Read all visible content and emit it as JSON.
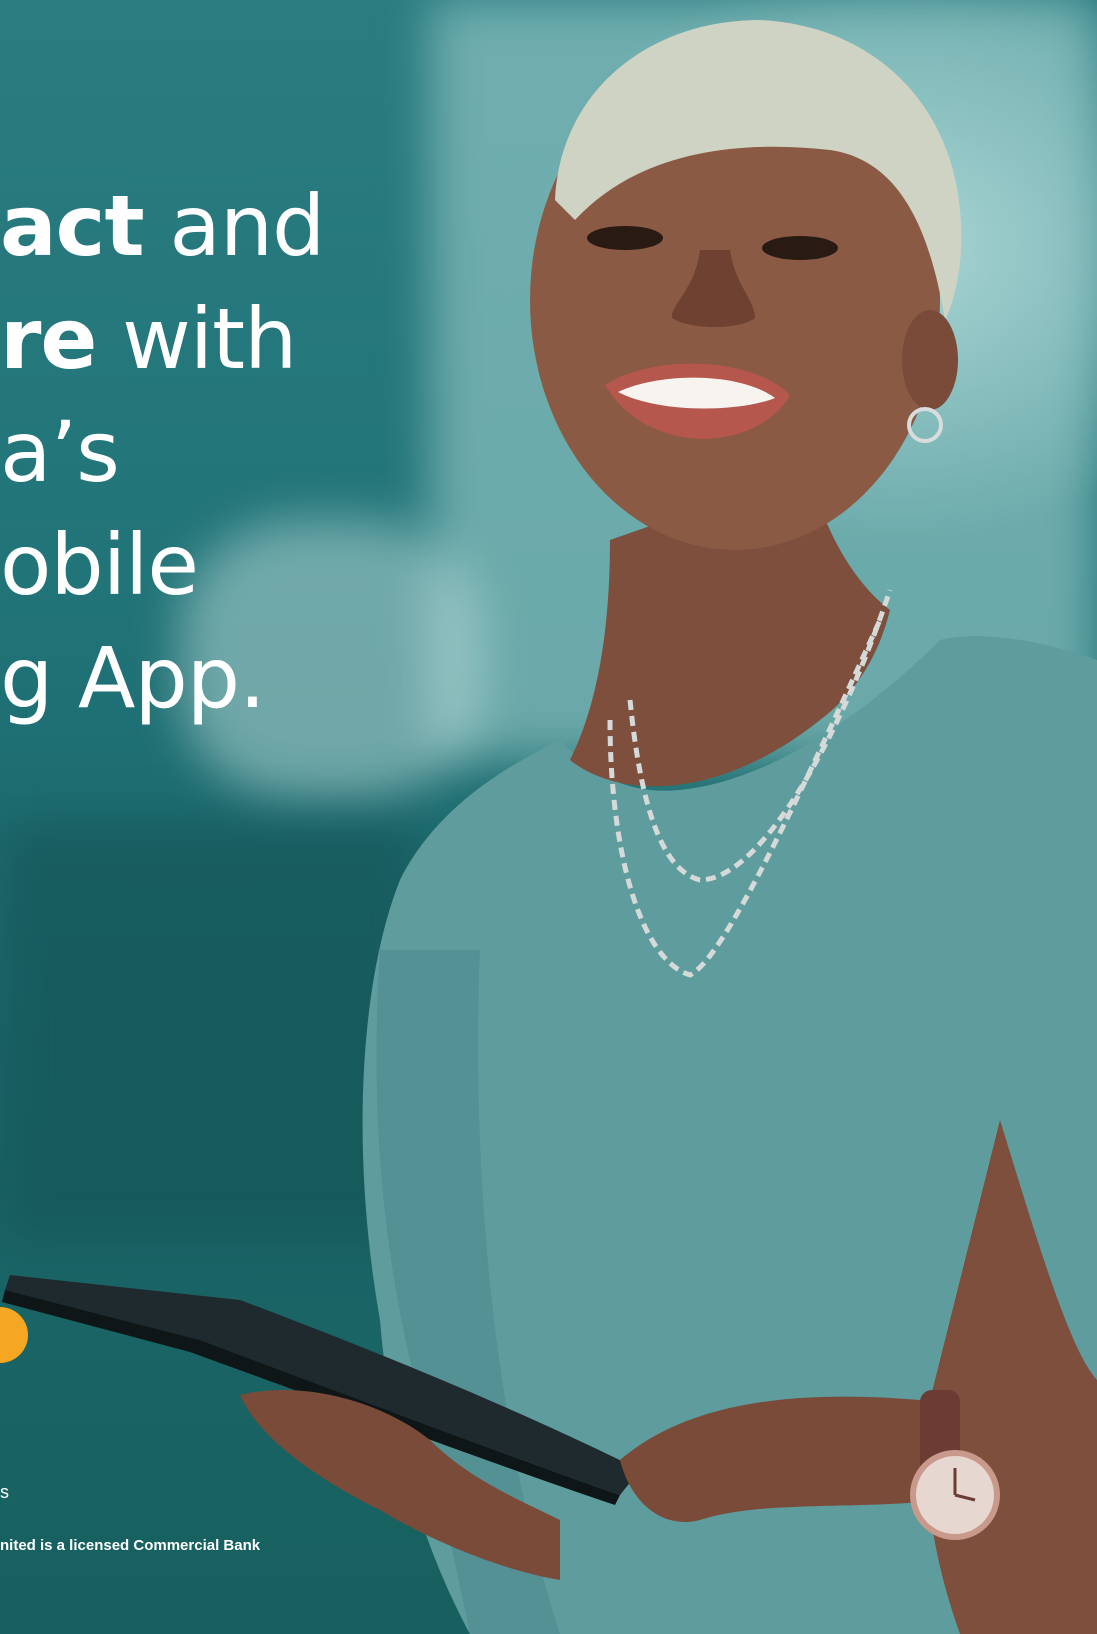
{
  "headline": {
    "line1_bold": "act",
    "line1_rest": " and",
    "line2_bold": "re",
    "line2_rest": " with",
    "line3": "a’s",
    "line4": "obile",
    "line5": "g App."
  },
  "footer": {
    "small_letter": "s",
    "disclaimer": "nited is a licensed Commercial Bank"
  },
  "colors": {
    "background": "#217478",
    "accent_dot": "#f5a623",
    "shirt": "#5f9ea0",
    "skin": "#8a5a44"
  }
}
